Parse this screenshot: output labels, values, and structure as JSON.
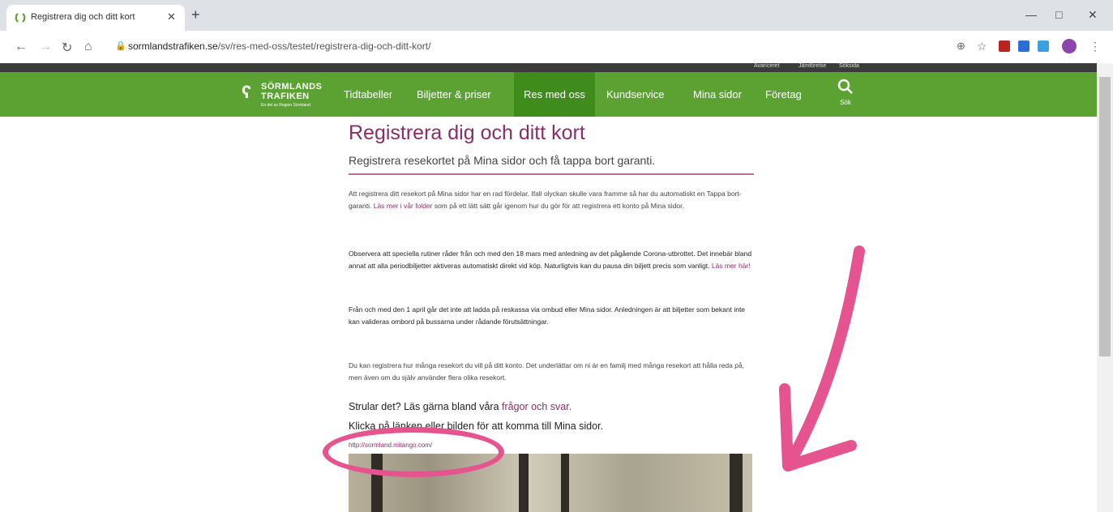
{
  "browser": {
    "tab_title": "Registrera dig och ditt kort",
    "url_domain": "sormlandstrafiken.se",
    "url_path": "/sv/res-med-oss/testet/registrera-dig-och-ditt-kort/"
  },
  "top_links": [
    "Avanceret",
    "Jämförelse",
    "Söksida"
  ],
  "logo": {
    "line1": "SÖRMLANDS",
    "line2": "TRAFIKEN",
    "tagline": "En del av Region Sörmland"
  },
  "nav": [
    "Tidtabeller",
    "Biljetter & priser",
    "Res med oss",
    "Kundservice",
    "Mina sidor",
    "Företag"
  ],
  "search_label": "Sök",
  "article": {
    "title": "Registrera dig och ditt kort",
    "subtitle": "Registrera resekortet på Mina sidor och få tappa bort garanti.",
    "p1_a": "Att registrera ditt resekort på Mina sidor har en rad fördelar. Ifall olyckan skulle vara framme så har du automatiskt en Tappa bort-garanti. ",
    "p1_link": "Läs mer i vår folder",
    "p1_b": " som på ett lätt sätt går igenom hur du gör för att registrera ett konto på Mina sidor.",
    "p2": "Observera att speciella rutiner råder från och med den 18 mars med anledning av det pågående Corona-utbrottet. Det innebär bland annat att alla periodbiljetter aktiveras automatiskt direkt vid köp. Naturligtvis kan du pausa din biljett precis som vanligt. ",
    "p2_link": "Läs mer här!",
    "p3": "Från och med den 1 april går det inte att ladda på reskassa via ombud eller Mina sidor. Anledningen är att biljetter som bekant inte kan valideras ombord på bussarna under rådande förutsättningar.",
    "p4": "Du kan registrera hur många resekort du vill på ditt konto. Det underlättar om ni är en familj med många resekort att hålla reda på, men även om du själv använder flera olika resekort.",
    "h_faq_prefix": "Strular det? Läs gärna bland våra ",
    "h_faq_link": "frågor och svar.",
    "h_click": "Klicka på länken eller bilden för att komma till Mina sidor.",
    "mina_sidor_url": "http://sormland.mitango.com/"
  },
  "colors": {
    "green": "#5ba233",
    "active_green": "#3f8c1d",
    "purple": "#8b2d6b",
    "annotation_pink": "#e5548e"
  }
}
